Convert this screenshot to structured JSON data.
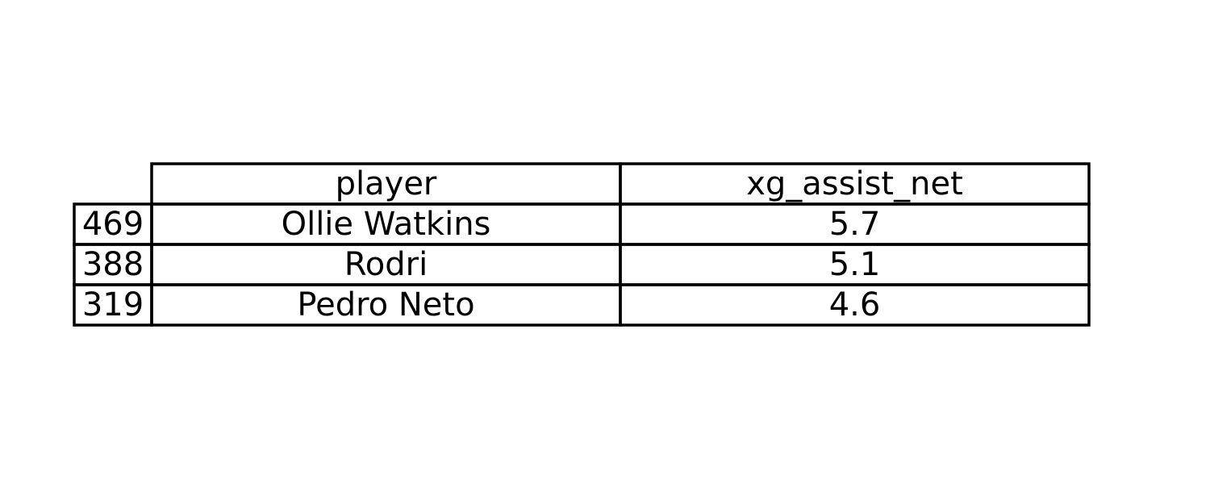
{
  "chart_data": {
    "type": "table",
    "columns": [
      "player",
      "xg_assist_net"
    ],
    "rows": [
      {
        "index": "469",
        "player": "Ollie Watkins",
        "xg_assist_net": "5.7"
      },
      {
        "index": "388",
        "player": "Rodri",
        "xg_assist_net": "5.1"
      },
      {
        "index": "319",
        "player": "Pedro Neto",
        "xg_assist_net": "4.6"
      }
    ]
  }
}
